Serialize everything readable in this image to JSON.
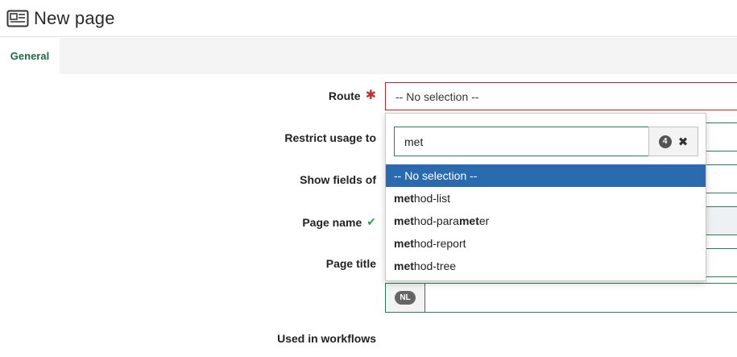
{
  "header": {
    "icon": "newspaper-icon",
    "title": "New page"
  },
  "tabs": [
    {
      "label": "General",
      "active": true
    }
  ],
  "form": {
    "route": {
      "label": "Route",
      "required": true,
      "value": "-- No selection --"
    },
    "restrict_usage": {
      "label": "Restrict usage to"
    },
    "show_fields": {
      "label": "Show fields of"
    },
    "page_name": {
      "label": "Page name",
      "valid": true
    },
    "page_title": {
      "label": "Page title",
      "language_badge": "NL"
    },
    "used_in_workflows": {
      "label": "Used in workflows"
    }
  },
  "dropdown": {
    "search_value": "met",
    "result_count": "4",
    "options": [
      {
        "match": "",
        "rest": "-- No selection --",
        "selected": true
      },
      {
        "match": "met",
        "rest": "hod-list",
        "selected": false
      },
      {
        "match": "met",
        "rest": "hod-para",
        "match2": "met",
        "rest2": "er",
        "selected": false
      },
      {
        "match": "met",
        "rest": "hod-report",
        "selected": false
      },
      {
        "match": "met",
        "rest": "hod-tree",
        "selected": false
      }
    ]
  },
  "colors": {
    "accent_green": "#2c7a5a",
    "error_red": "#b3222d",
    "selected_blue": "#2a6bb0",
    "tab_text": "#1e6b4a"
  }
}
